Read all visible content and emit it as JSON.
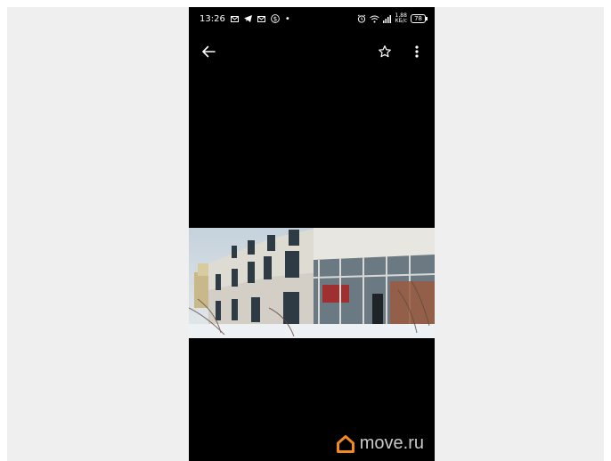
{
  "status_bar": {
    "time": "13:26",
    "left_icons": [
      "mail-icon",
      "telegram-icon",
      "mail-icon",
      "dollar-app-icon",
      "dot-icon"
    ],
    "dot": "•",
    "network_top": "1,88",
    "network_bottom": "КБ/с",
    "battery": "78"
  },
  "toolbar": {
    "back_icon": "arrow-left-icon",
    "favorite_icon": "star-outline-icon",
    "more_icon": "more-vert-icon"
  },
  "watermark": {
    "text": "move.ru",
    "logo_color": "#f28a1e"
  },
  "colors": {
    "background": "#efefef",
    "viewer": "#000000",
    "foreground": "#ffffff"
  }
}
